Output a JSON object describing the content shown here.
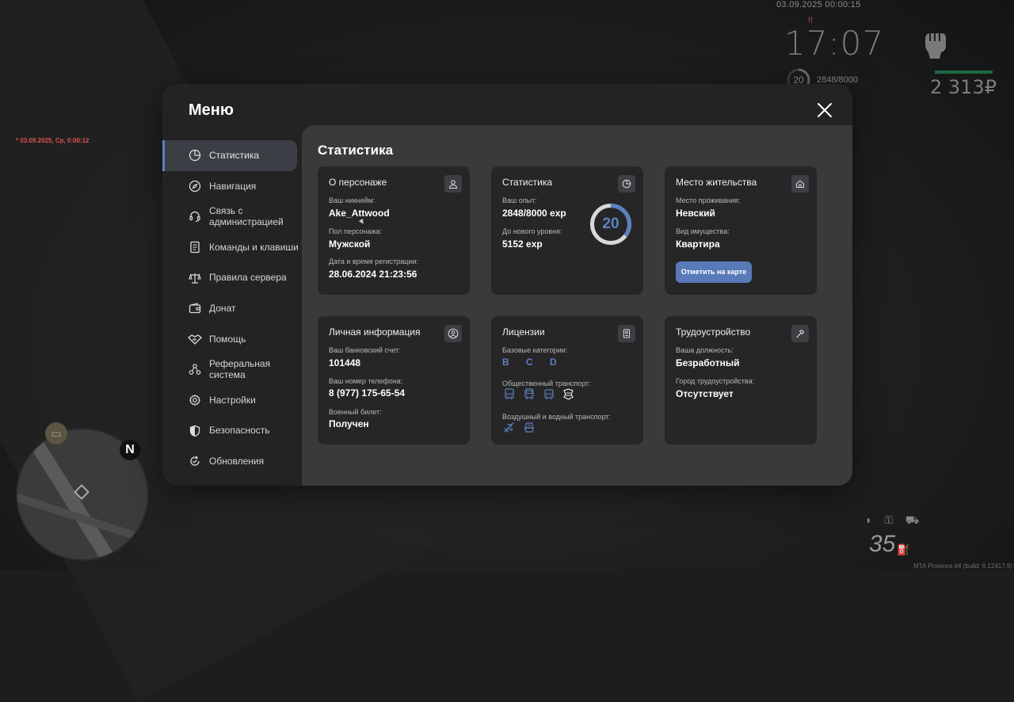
{
  "hud": {
    "date": "03.09.2025 00:00:15",
    "red_mark": "!!",
    "time": "17:07",
    "level": "20",
    "exp": "2848/8000",
    "money": "2 313₽",
    "red_timestamp": "* 03.09.2025, Ср, 0:00:12",
    "speed": "35",
    "build": "MTA Province #4 (build: 6.12417.9)"
  },
  "menu": {
    "title": "Меню",
    "sidebar": [
      {
        "label": "Статистика",
        "icon": "pie-chart-icon",
        "active": true
      },
      {
        "label": "Навигация",
        "icon": "compass-icon"
      },
      {
        "label": "Связь с администрацией",
        "icon": "headset-icon"
      },
      {
        "label": "Команды и клавиши",
        "icon": "document-icon"
      },
      {
        "label": "Правила сервера",
        "icon": "scales-icon"
      },
      {
        "label": "Донат",
        "icon": "wallet-icon"
      },
      {
        "label": "Помощь",
        "icon": "handshake-icon"
      },
      {
        "label": "Реферальная система",
        "icon": "network-icon"
      },
      {
        "label": "Настройки",
        "icon": "gear-icon"
      },
      {
        "label": "Безопасность",
        "icon": "shield-icon"
      },
      {
        "label": "Обновления",
        "icon": "refresh-icon"
      }
    ]
  },
  "content": {
    "title": "Статистика",
    "character": {
      "title": "О персонаже",
      "nickname_label": "Ваш никнейм:",
      "nickname": "Ake_Attwood",
      "gender_label": "Пол персонажа:",
      "gender": "Мужской",
      "reg_label": "Дата и время регистрации:",
      "reg": "28.06.2024 21:23:56"
    },
    "stats": {
      "title": "Статистика",
      "exp_label": "Ваш опыт:",
      "exp": "2848/8000 exp",
      "next_label": "До нового уровня:",
      "next": "5152 exp",
      "level": "20",
      "progress": 0.356
    },
    "residence": {
      "title": "Место жительства",
      "place_label": "Место проживания:",
      "place": "Невский",
      "property_label": "Вид имущества:",
      "property": "Квартира",
      "button": "Отметить на карте"
    },
    "personal": {
      "title": "Личная информация",
      "bank_label": "Ваш банковский счет:",
      "bank": "101448",
      "phone_label": "Ваш номер телефона:",
      "phone": "8 (977) 175-65-54",
      "military_label": "Военный билет:",
      "military": "Получен"
    },
    "licenses": {
      "title": "Лицензии",
      "base_label": "Базовые категории:",
      "base": "B C D",
      "public_label": "Общественный транспорт:",
      "air_label": "Воздушный и водный транспорт:"
    },
    "employment": {
      "title": "Трудоустройство",
      "position_label": "Ваша должность:",
      "position": "Безработный",
      "city_label": "Город трудоустройства:",
      "city": "Отсутствует"
    }
  },
  "colors": {
    "accent": "#5c80c2",
    "button": "#587ab9",
    "card": "#262626",
    "panel": "#3a3a3a"
  }
}
